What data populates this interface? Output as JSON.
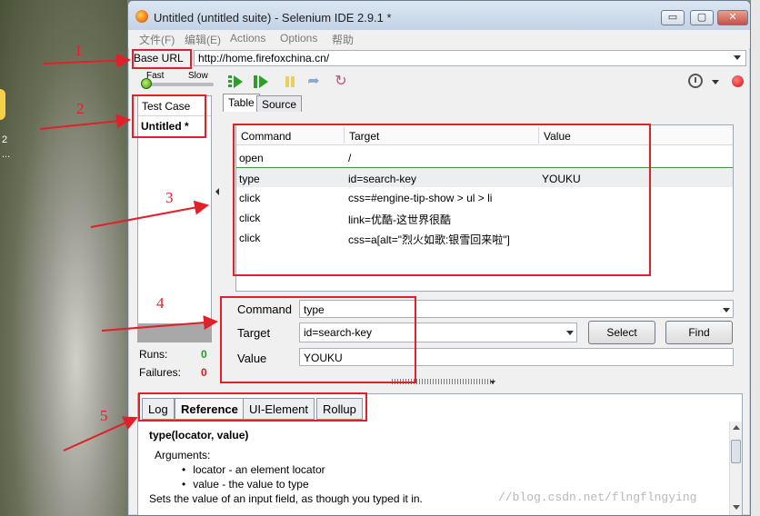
{
  "desktop": {
    "bg_number": "2",
    "bg_dots": "..."
  },
  "window": {
    "title": "Untitled (untitled suite) - Selenium IDE 2.9.1 *",
    "controls": {
      "minimize": "▭",
      "maximize": "▢",
      "close": "✕"
    }
  },
  "menu": [
    "文件(F)",
    "编辑(E)",
    "Actions",
    "Options",
    "帮助"
  ],
  "base_url": {
    "label": "Base URL",
    "value": "http://home.firefoxchina.cn/"
  },
  "toolbar": {
    "speed_fast": "Fast",
    "speed_slow": "Slow"
  },
  "test_case_panel": {
    "header": "Test Case",
    "items": [
      "Untitled *"
    ],
    "runs_label": "Runs:",
    "runs_value": "0",
    "failures_label": "Failures:",
    "failures_value": "0"
  },
  "tabs": {
    "table": "Table",
    "source": "Source"
  },
  "commands_table": {
    "headers": [
      "Command",
      "Target",
      "Value"
    ],
    "rows": [
      {
        "command": "open",
        "target": "/",
        "value": ""
      },
      {
        "command": "type",
        "target": "id=search-key",
        "value": "YOUKU"
      },
      {
        "command": "click",
        "target": "css=#engine-tip-show > ul > li",
        "value": ""
      },
      {
        "command": "click",
        "target": "link=优酷-这世界很酷",
        "value": ""
      },
      {
        "command": "click",
        "target": "css=a[alt=\"烈火如歌:银雪回来啦\"]",
        "value": ""
      }
    ]
  },
  "editor": {
    "command_label": "Command",
    "command_value": "type",
    "target_label": "Target",
    "target_value": "id=search-key",
    "value_label": "Value",
    "value_value": "YOUKU",
    "select_button": "Select",
    "find_button": "Find"
  },
  "bottom_tabs": [
    "Log",
    "Reference",
    "UI-Element",
    "Rollup"
  ],
  "reference": {
    "title": "type(locator, value)",
    "arguments_label": "Arguments:",
    "arguments": [
      "locator - an element locator",
      "value - the value to type"
    ],
    "description": "Sets the value of an input field, as though you typed it in."
  },
  "annotations": [
    "1",
    "2",
    "3",
    "4",
    "5"
  ],
  "watermark": "//blog.csdn.net/flngflngying",
  "colors": {
    "annotation_red": "#e0202a",
    "runs_green": "#2a9a2a",
    "failures_red": "#d02020"
  }
}
